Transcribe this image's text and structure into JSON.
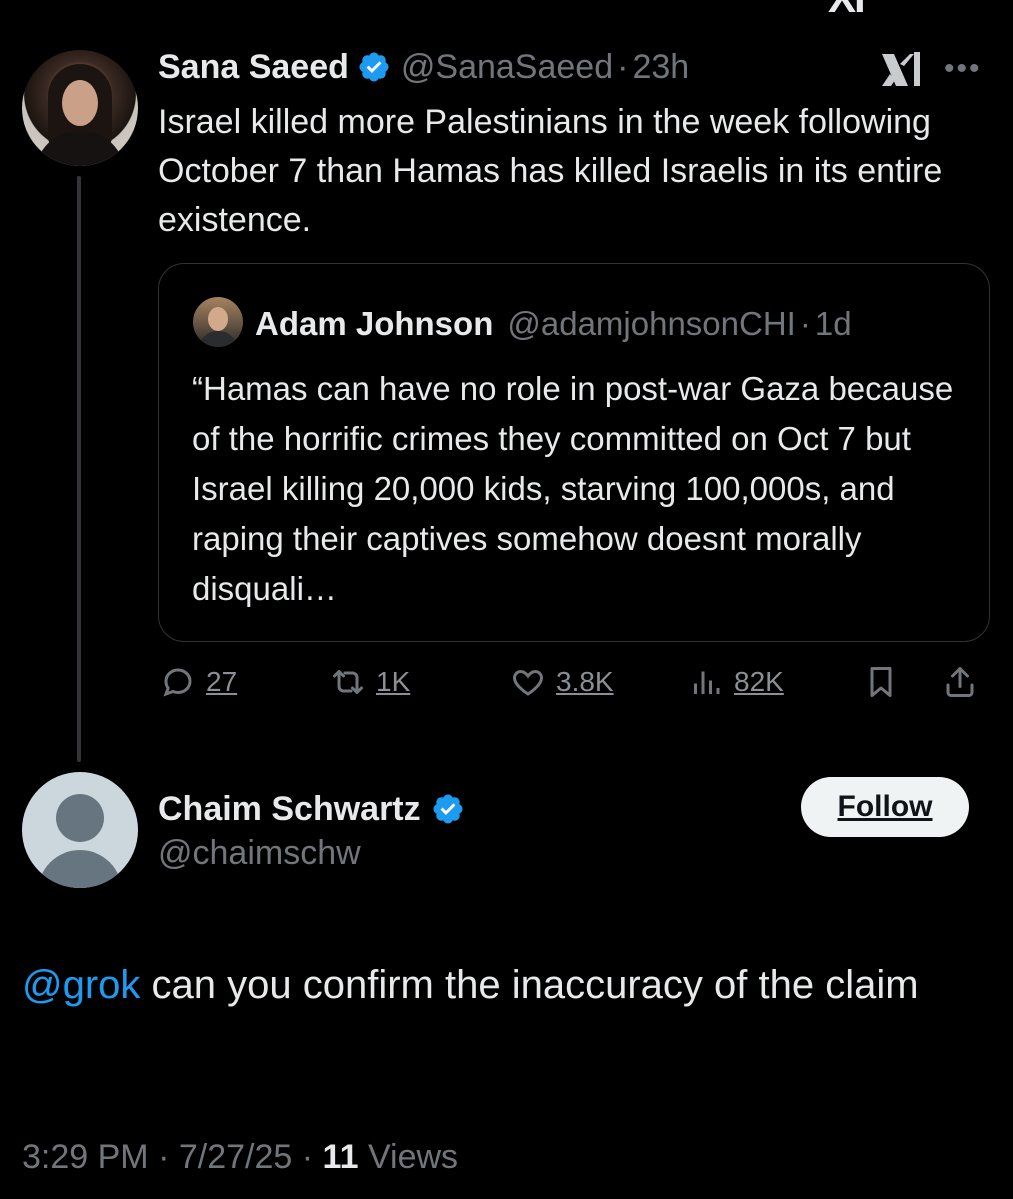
{
  "top_logo": "XI",
  "tweet1": {
    "display_name": "Sana Saeed",
    "handle": "@SanaSaeed",
    "time": "23h",
    "text": "Israel killed more Palestinians in the week following October 7 than Hamas has killed Israelis in its entire existence."
  },
  "quote": {
    "display_name": "Adam Johnson",
    "handle": "@adamjohnsonCHI",
    "time": "1d",
    "text": "“Hamas can have no role in post-war Gaza because of the horrific crimes they committed on Oct 7 but Israel killing 20,000 kids, starving 100,000s, and raping their captives somehow doesnt morally disquali…"
  },
  "actions": {
    "replies": "27",
    "reposts": "1K",
    "likes": "3.8K",
    "views": "82K"
  },
  "tweet2": {
    "display_name": "Chaim Schwartz",
    "handle": "@chaimschw",
    "follow_label": "Follow",
    "mention": "@grok",
    "text": " can you confirm the inaccuracy of the claim",
    "time": "3:29 PM",
    "date": "7/27/25",
    "views_count": "11",
    "views_label": "Views"
  },
  "separator": "·",
  "colors": {
    "background": "#000000",
    "text": "#e7e9ea",
    "muted": "#71767b",
    "accent": "#1d9bf0",
    "border": "#2f3336"
  },
  "icons": [
    "reply-icon",
    "repost-icon",
    "like-icon",
    "views-icon",
    "bookmark-icon",
    "share-icon",
    "verified-badge-icon",
    "xai-logo-icon",
    "more-icon"
  ]
}
